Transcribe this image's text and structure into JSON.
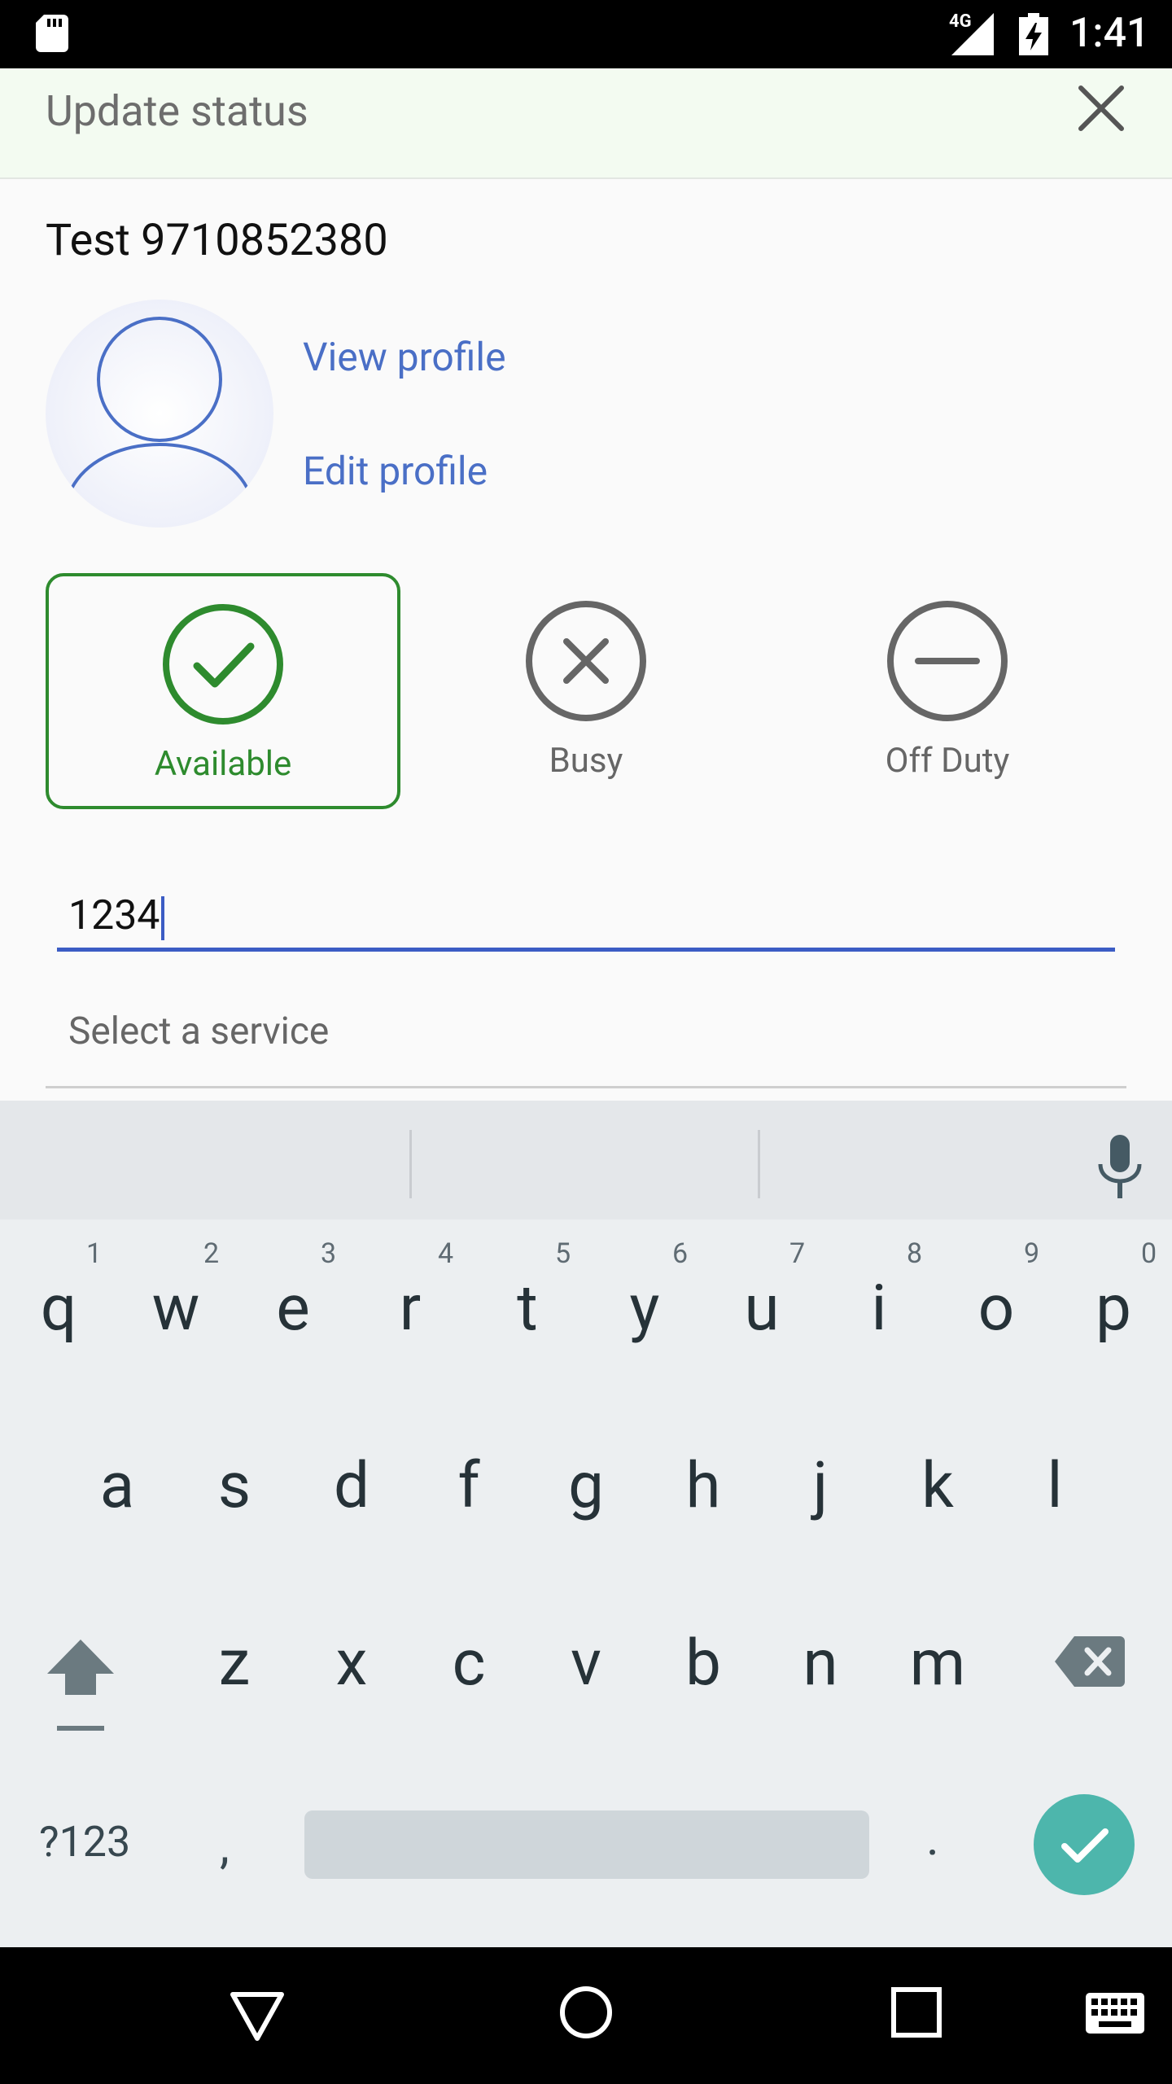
{
  "status_bar": {
    "network": "4G",
    "time": "1:41"
  },
  "header": {
    "title": "Update status"
  },
  "profile": {
    "name": "Test 9710852380",
    "view_link": "View profile",
    "edit_link": "Edit profile"
  },
  "status_options": [
    {
      "label": "Available",
      "selected": true,
      "color": "#2e8b2e"
    },
    {
      "label": "Busy",
      "selected": false,
      "color": "#666666"
    },
    {
      "label": "Off Duty",
      "selected": false,
      "color": "#666666"
    }
  ],
  "form": {
    "input_value": "1234",
    "select_placeholder": "Select a service"
  },
  "keyboard": {
    "row1": [
      "q",
      "w",
      "e",
      "r",
      "t",
      "y",
      "u",
      "i",
      "o",
      "p"
    ],
    "row1_hints": [
      "1",
      "2",
      "3",
      "4",
      "5",
      "6",
      "7",
      "8",
      "9",
      "0"
    ],
    "row2": [
      "a",
      "s",
      "d",
      "f",
      "g",
      "h",
      "j",
      "k",
      "l"
    ],
    "row3": [
      "z",
      "x",
      "c",
      "v",
      "b",
      "n",
      "m"
    ],
    "symbols_key": "?123",
    "comma": ",",
    "period": "."
  },
  "colors": {
    "accent": "#3b5cc4",
    "available": "#2e8b2e",
    "enter_key": "#4db6ac"
  }
}
